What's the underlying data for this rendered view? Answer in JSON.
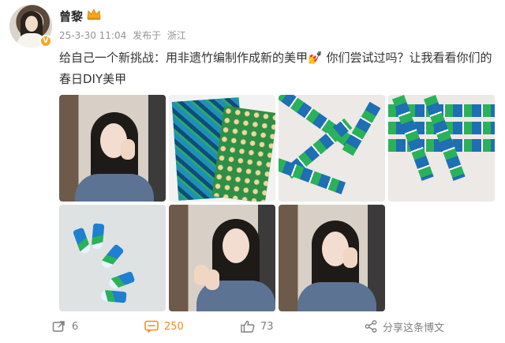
{
  "user": {
    "name": "曾黎"
  },
  "meta": {
    "date": "25-3-30 11:04",
    "source_prefix": "发布于",
    "location": "浙江"
  },
  "post": {
    "text": "给自己一个新挑战：用非遗竹编制作成新的美甲💅 你们尝试过吗？让我看看你们的春日DIY美甲"
  },
  "images": [
    {
      "kind": "portrait",
      "icon": "photo-portrait-hand-at-chin"
    },
    {
      "kind": "fabric",
      "icon": "photo-woven-fabric"
    },
    {
      "kind": "weave",
      "icon": "photo-weave-closeup"
    },
    {
      "kind": "weave",
      "icon": "photo-weave-pattern"
    },
    {
      "kind": "pieces",
      "icon": "photo-nail-pieces"
    },
    {
      "kind": "portrait",
      "icon": "photo-portrait-showing-nails"
    },
    {
      "kind": "portrait",
      "icon": "photo-portrait-smiling"
    }
  ],
  "actions": {
    "repost_count": "6",
    "comment_count": "250",
    "like_count": "73",
    "share_label": "分享这条博文"
  },
  "colors": {
    "accent": "#f28b1b",
    "muted": "#939393",
    "verified": "#f6a623"
  }
}
